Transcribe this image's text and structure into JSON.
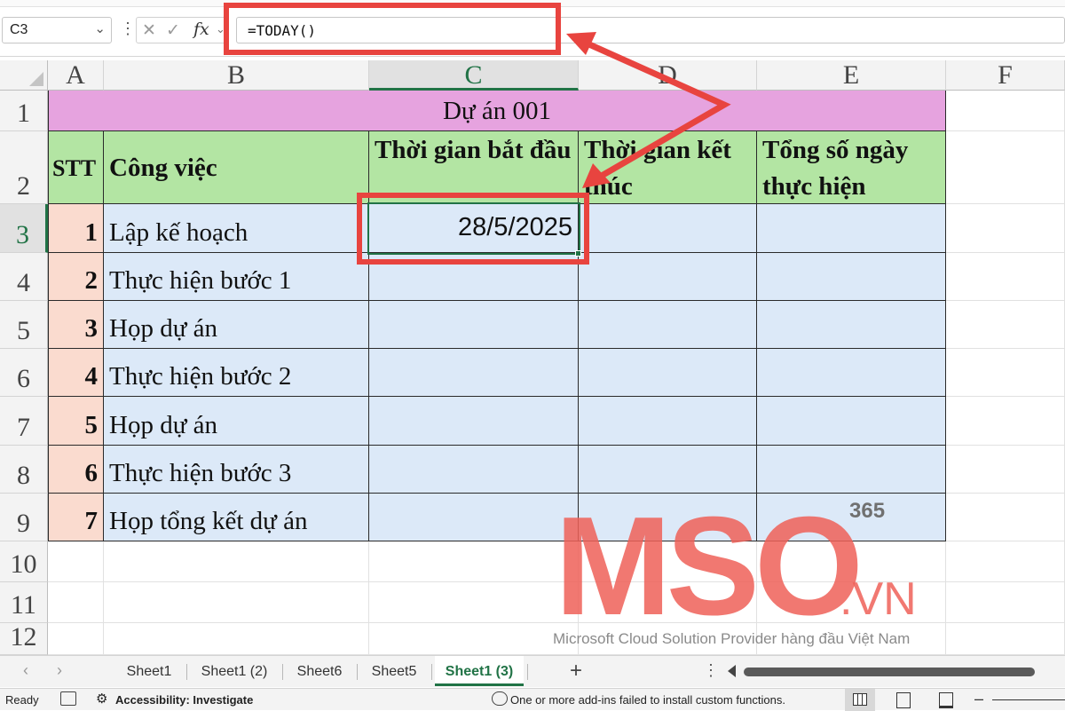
{
  "formula_bar": {
    "name_box": "C3",
    "fx_label": "fx",
    "cancel_glyph": "✕",
    "enter_glyph": "✓",
    "formula": "=TODAY()"
  },
  "columns": [
    "A",
    "B",
    "C",
    "D",
    "E",
    "F"
  ],
  "rows": [
    "1",
    "2",
    "3",
    "4",
    "5",
    "6",
    "7",
    "8",
    "9",
    "10",
    "11",
    "12"
  ],
  "table": {
    "title": "Dự án 001",
    "headers": {
      "stt": "STT",
      "task": "Công việc",
      "start": "Thời gian bắt đầu",
      "end": "Thời gian kết thúc",
      "total": "Tổng số ngày thực hiện"
    },
    "rows": [
      {
        "stt": "1",
        "task": "Lập kế hoạch",
        "start": "28/5/2025"
      },
      {
        "stt": "2",
        "task": "Thực hiện bước 1",
        "start": ""
      },
      {
        "stt": "3",
        "task": "Họp dự án",
        "start": ""
      },
      {
        "stt": "4",
        "task": "Thực hiện bước 2",
        "start": ""
      },
      {
        "stt": "5",
        "task": "Họp dự án",
        "start": ""
      },
      {
        "stt": "6",
        "task": "Thực hiện bước 3",
        "start": ""
      },
      {
        "stt": "7",
        "task": "Họp tổng kết dự án",
        "start": ""
      }
    ]
  },
  "sheet_tabs": [
    "Sheet1",
    "Sheet1 (2)",
    "Sheet6",
    "Sheet5",
    "Sheet1 (3)"
  ],
  "active_tab": "Sheet1 (3)",
  "status_bar": {
    "ready": "Ready",
    "accessibility": "Accessibility: Investigate",
    "message": "One or more add-ins failed to install custom functions."
  },
  "watermark": {
    "logo_text": "MSO",
    "suffix": ".VN",
    "badge": "365",
    "tagline": "Microsoft Cloud Solution Provider hàng đầu Việt Nam"
  },
  "colors": {
    "title_fill": "#e6a3df",
    "header_fill": "#b3e5a3",
    "body_fill": "#dce9f8",
    "stt_fill": "#fadbcf",
    "highlight": "#e8443f",
    "excel_green": "#217346"
  }
}
